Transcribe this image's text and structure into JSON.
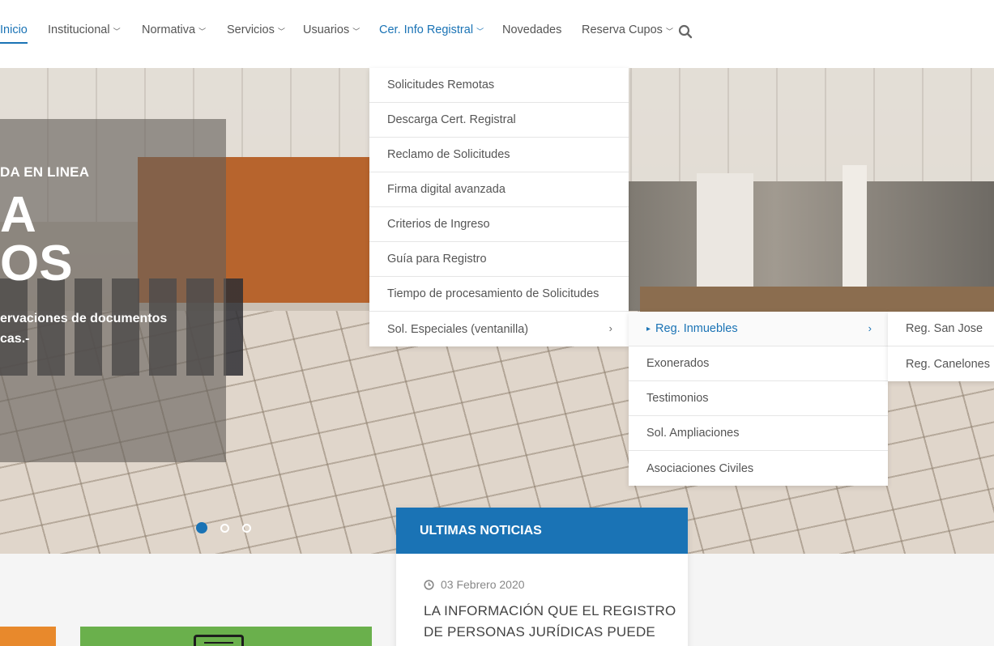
{
  "nav": {
    "items": [
      {
        "label": "Inicio",
        "chevron": false
      },
      {
        "label": "Institucional",
        "chevron": true
      },
      {
        "label": "Normativa",
        "chevron": true
      },
      {
        "label": "Servicios",
        "chevron": true
      },
      {
        "label": "Usuarios",
        "chevron": true
      },
      {
        "label": "Cer. Info Registral",
        "chevron": true
      },
      {
        "label": "Novedades",
        "chevron": false
      },
      {
        "label": "Reserva Cupos",
        "chevron": true
      }
    ],
    "chevron_glyph": "﹀",
    "search_icon": "search-icon",
    "accent_color": "#1a73b5"
  },
  "hero": {
    "eyebrow": "DA EN LINEA",
    "big_line1": "A",
    "big_line2": "OS",
    "text_line1": "ervaciones de documentos",
    "text_line2": "cas.-"
  },
  "dropdown": {
    "items": [
      "Solicitudes Remotas",
      "Descarga Cert. Registral",
      "Reclamo de Solicitudes",
      "Firma digital avanzada",
      "Criterios de Ingreso",
      "Guía para Registro",
      "Tiempo de procesamiento de Solicitudes",
      "Sol. Especiales (ventanilla)"
    ],
    "submenu_arrow": "›"
  },
  "submenu": {
    "items": [
      "Reg. Inmuebles",
      "Exonerados",
      "Testimonios",
      "Sol. Ampliaciones",
      "Asociaciones Civiles"
    ],
    "caret": "▸"
  },
  "submenu2": {
    "items": [
      "Reg. San Jose",
      "Reg. Canelones"
    ]
  },
  "news": {
    "heading": "ULTIMAS NOTICIAS",
    "date": "03 Febrero 2020",
    "title_line1": "LA INFORMACIÓN QUE EL REGISTRO",
    "title_line2": "DE PERSONAS JURÍDICAS PUEDE"
  },
  "colors": {
    "accent": "#1a73b5",
    "tile_orange": "#e8892c",
    "tile_green": "#6ab04c"
  }
}
